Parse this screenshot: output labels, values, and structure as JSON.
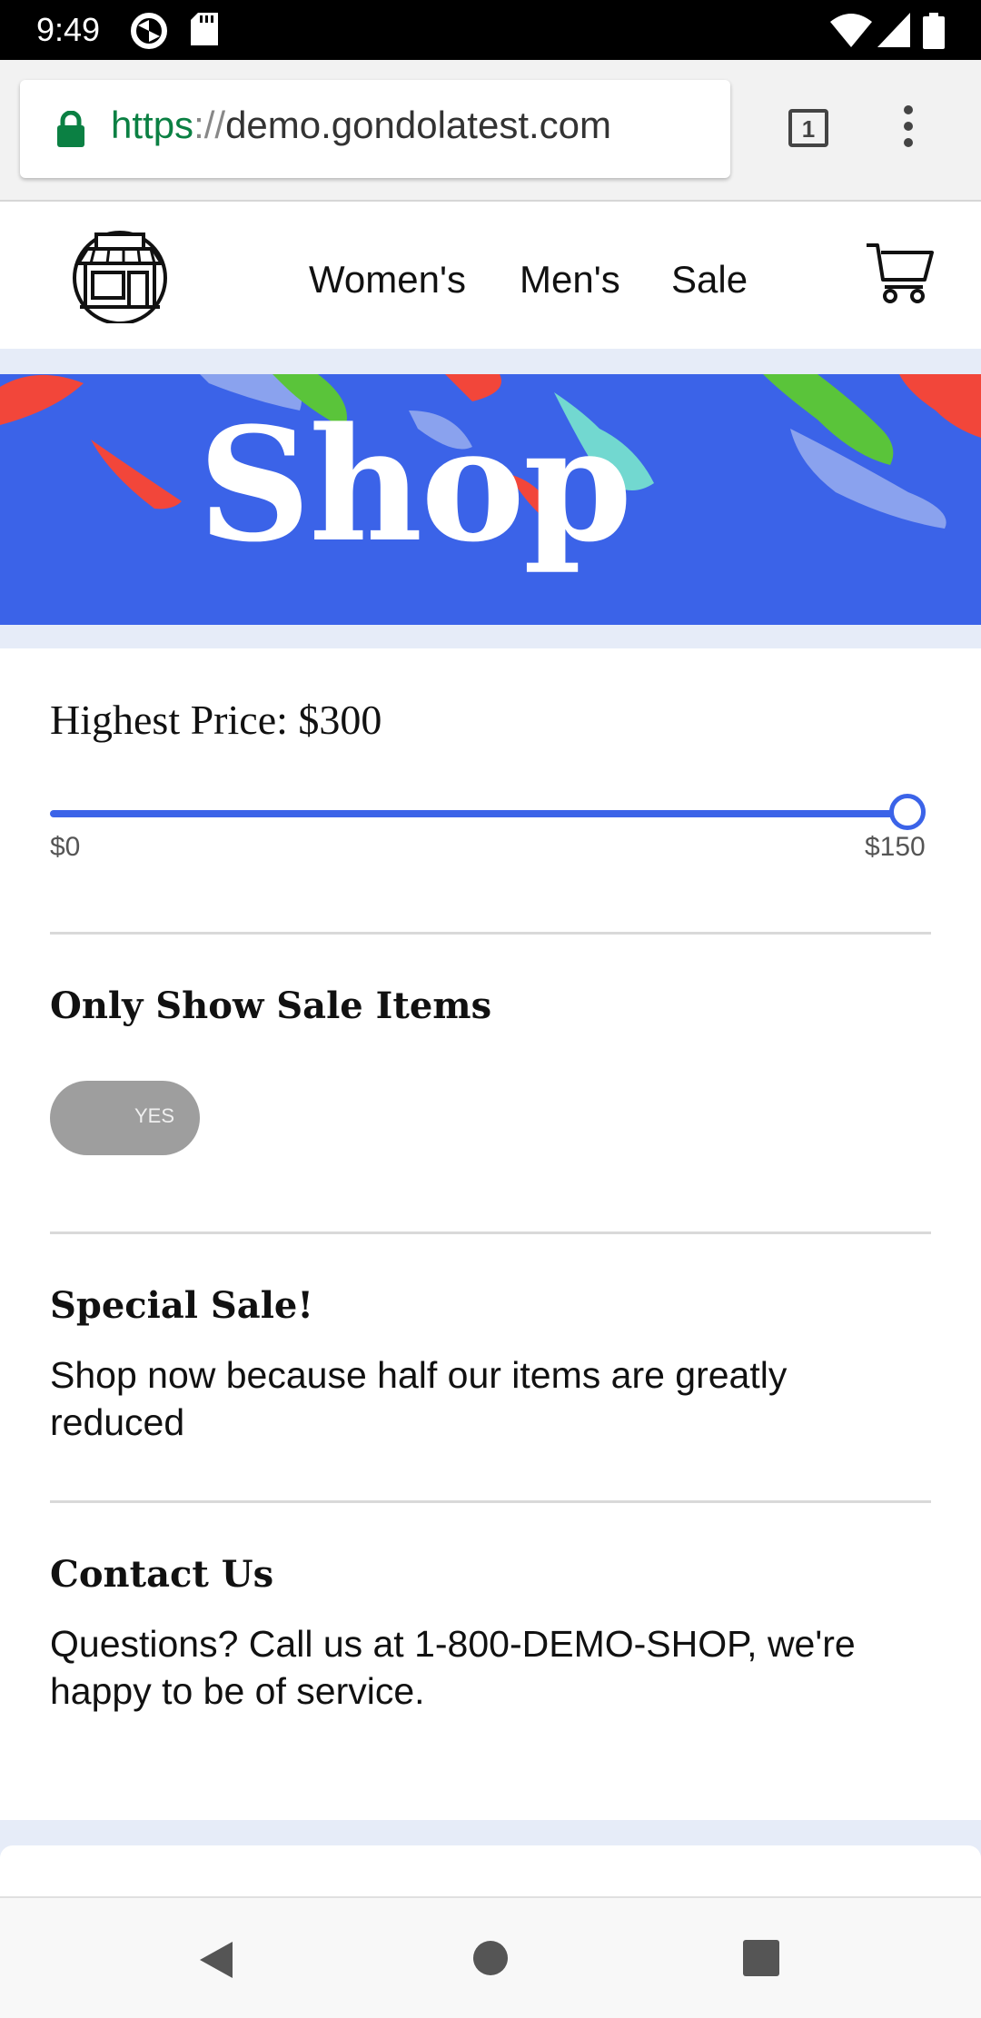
{
  "status_bar": {
    "time": "9:49",
    "icons": [
      "sync-icon",
      "sd-card-icon",
      "wifi-icon",
      "signal-icon",
      "battery-icon"
    ]
  },
  "browser": {
    "url_scheme": "https",
    "url_separator": "://",
    "url_host": "demo.gondolatest.com",
    "tab_count": "1",
    "icons": [
      "lock-icon",
      "menu-dots-icon"
    ]
  },
  "site": {
    "nav": [
      {
        "label": "Women's"
      },
      {
        "label": "Men's"
      },
      {
        "label": "Sale"
      }
    ],
    "icons": [
      "store-logo-icon",
      "cart-icon"
    ]
  },
  "banner": {
    "title": "Shop",
    "background_color": "#3b63e8"
  },
  "filters": {
    "price_label": "Highest Price: $300",
    "slider": {
      "min_label": "$0",
      "max_label": "$150",
      "position_fraction": 1.0
    },
    "sale_title": "Only Show Sale Items",
    "toggle_label": "YES"
  },
  "special_sale": {
    "title": "Special Sale!",
    "text": "Shop now because half our items are greatly reduced"
  },
  "contact": {
    "title": "Contact Us",
    "text": "Questions? Call us at 1-800-DEMO-SHOP, we're happy to be of service."
  },
  "android_nav": {
    "icons": [
      "back-icon",
      "home-icon",
      "recents-icon"
    ]
  },
  "colors": {
    "accent": "#3b63e8",
    "page_background": "#e6ecf8",
    "secure_green": "#0b8043"
  }
}
